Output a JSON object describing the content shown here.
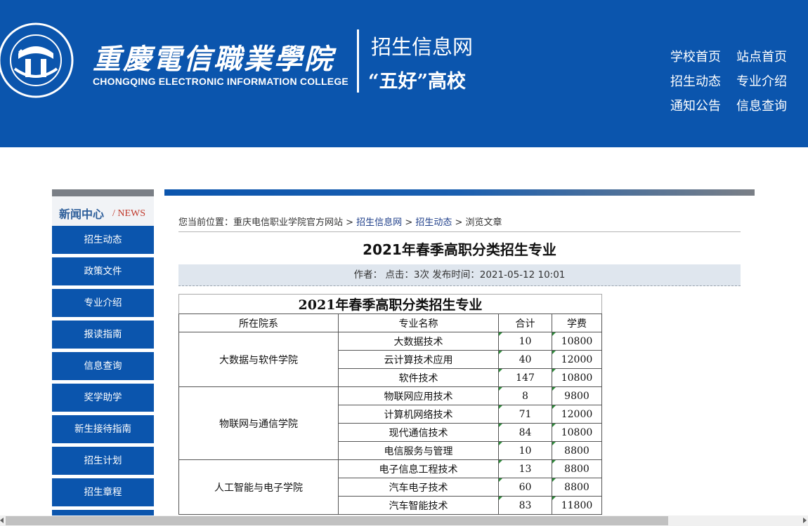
{
  "header": {
    "seal_text": "重庆电信职业学院 CHONGQING ELECTRONIC INFORMATION COLLEGE",
    "school_name_cn": "重慶電信職業學院",
    "school_name_en": "CHONGQING ELECTRONIC INFORMATION COLLEGE",
    "site_name": "招生信息网",
    "motto": "“五好”高校",
    "nav": [
      "学校首页",
      "站点首页",
      "招生动态",
      "专业介绍",
      "通知公告",
      "信息查询"
    ]
  },
  "sidebar": {
    "title_cn": "新闻中心",
    "title_en": "/ NEWS",
    "items": [
      "招生动态",
      "政策文件",
      "专业介绍",
      "报读指南",
      "信息查询",
      "奖学助学",
      "新生接待指南",
      "招生计划",
      "招生章程"
    ]
  },
  "breadcrumb": {
    "prefix": "您当前位置：重庆电信职业学院官方网站 >",
    "link1": "招生信息网",
    "sep": ">",
    "link2": "招生动态",
    "tail": "> 浏览文章"
  },
  "article": {
    "title": "2021年春季高职分类招生专业",
    "meta": "作者：    点击：3次    发布时间：2021-05-12 10:01"
  },
  "table": {
    "caption": "2021年春季高职分类招生专业",
    "headers": [
      "所在院系",
      "专业名称",
      "合计",
      "学费"
    ],
    "groups": [
      {
        "dept": "大数据与软件学院",
        "rows": [
          [
            "大数据技术",
            "10",
            "10800"
          ],
          [
            "云计算技术应用",
            "40",
            "12000"
          ],
          [
            "软件技术",
            "147",
            "10800"
          ]
        ]
      },
      {
        "dept": "物联网与通信学院",
        "rows": [
          [
            "物联网应用技术",
            "8",
            "9800"
          ],
          [
            "计算机网络技术",
            "71",
            "12000"
          ],
          [
            "现代通信技术",
            "84",
            "10800"
          ],
          [
            "电信服务与管理",
            "10",
            "8800"
          ]
        ]
      },
      {
        "dept": "人工智能与电子学院",
        "rows": [
          [
            "电子信息工程技术",
            "13",
            "8800"
          ],
          [
            "汽车电子技术",
            "60",
            "8800"
          ],
          [
            "汽车智能技术",
            "83",
            "11800"
          ]
        ]
      }
    ]
  },
  "colors": {
    "brand": "#0b55ad",
    "sidebar_title": "#2d5e9a",
    "news_red": "#c0392b"
  },
  "icons": {
    "seal": "college-seal-icon"
  }
}
